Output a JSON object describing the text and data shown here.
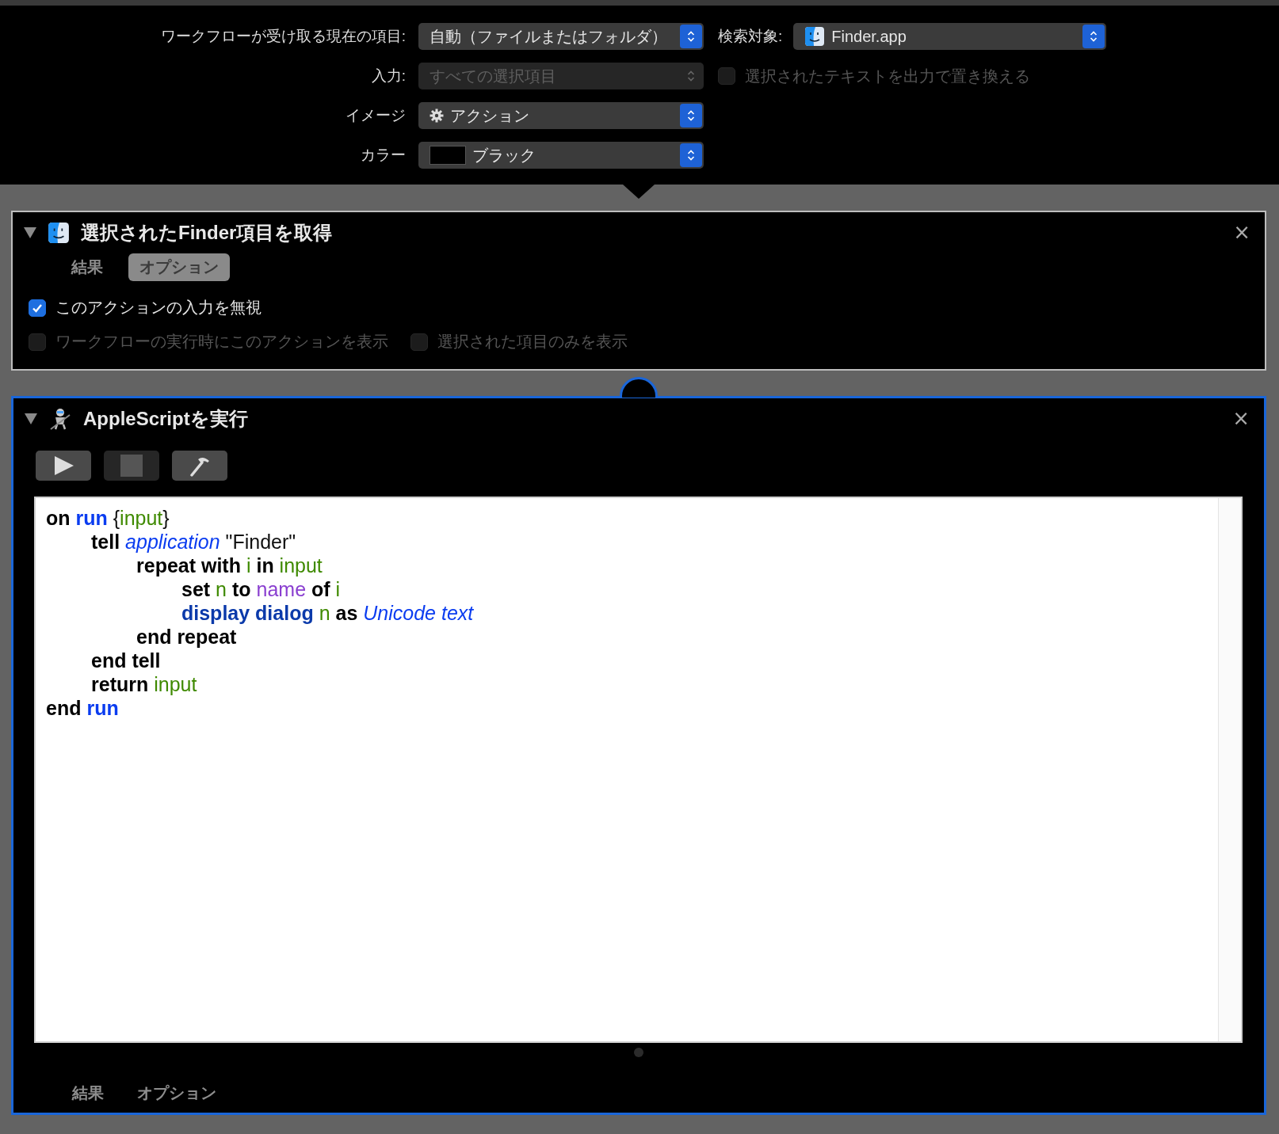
{
  "workflow_settings": {
    "rows": [
      {
        "label": "ワークフローが受け取る現在の項目:",
        "popup": {
          "kind": "plain",
          "value": "自動（ファイルまたはフォルダ）",
          "disabled": false
        },
        "extra": {
          "kind": "popup",
          "label": "検索対象:",
          "popup": {
            "kind": "app",
            "value": "Finder.app",
            "disabled": false
          }
        }
      },
      {
        "label": "入力:",
        "popup": {
          "kind": "plain",
          "value": "すべての選択項目",
          "disabled": true
        },
        "extra": {
          "kind": "checkbox",
          "label": "選択されたテキストを出力で置き換える",
          "checked": false,
          "disabled": true
        }
      },
      {
        "label": "イメージ",
        "popup": {
          "kind": "gear",
          "value": "アクション",
          "disabled": false
        }
      },
      {
        "label": "カラー",
        "popup": {
          "kind": "swatch",
          "value": "ブラック",
          "disabled": false
        }
      }
    ]
  },
  "actions": [
    {
      "kind": "finder",
      "title": "選択されたFinder項目を取得",
      "close": "×",
      "expanded": true,
      "focused": false,
      "tabs": [
        {
          "label": "結果",
          "selected": false
        },
        {
          "label": "オプション",
          "selected": true
        }
      ],
      "options": [
        [
          {
            "label": "このアクションの入力を無視",
            "checked": true,
            "disabled": false
          }
        ],
        [
          {
            "label": "ワークフローの実行時にこのアクションを表示",
            "checked": false,
            "disabled": true
          },
          {
            "label": "選択された項目のみを表示",
            "checked": false,
            "disabled": true
          }
        ]
      ]
    },
    {
      "kind": "script",
      "title": "AppleScriptを実行",
      "close": "×",
      "expanded": true,
      "focused": true,
      "toolbar": [
        {
          "kind": "run"
        },
        {
          "kind": "stop"
        },
        {
          "kind": "compile"
        }
      ],
      "code": [
        [
          {
            "kind": "keyword",
            "text": "on "
          },
          {
            "kind": "handler",
            "text": "run"
          },
          {
            "kind": "plain",
            "text": " {"
          },
          {
            "kind": "variable",
            "text": "input"
          },
          {
            "kind": "plain",
            "text": "}"
          }
        ],
        [
          {
            "kind": "keyword",
            "text": "\ttell "
          },
          {
            "kind": "class",
            "text": "application"
          },
          {
            "kind": "plain",
            "text": " \"Finder\""
          }
        ],
        [
          {
            "kind": "keyword",
            "text": "\t\trepeat with "
          },
          {
            "kind": "variable",
            "text": "i"
          },
          {
            "kind": "keyword",
            "text": " in "
          },
          {
            "kind": "variable",
            "text": "input"
          }
        ],
        [
          {
            "kind": "keyword",
            "text": "\t\t\tset "
          },
          {
            "kind": "variable",
            "text": "n"
          },
          {
            "kind": "keyword",
            "text": " to "
          },
          {
            "kind": "property",
            "text": "name"
          },
          {
            "kind": "keyword",
            "text": " of "
          },
          {
            "kind": "variable",
            "text": "i"
          }
        ],
        [
          {
            "kind": "command",
            "text": "\t\t\tdisplay dialog"
          },
          {
            "kind": "variable",
            "text": " n"
          },
          {
            "kind": "keyword",
            "text": " as "
          },
          {
            "kind": "class",
            "text": "Unicode text"
          }
        ],
        [
          {
            "kind": "keyword",
            "text": "\t\tend repeat"
          }
        ],
        [
          {
            "kind": "keyword",
            "text": "\tend tell"
          }
        ],
        [
          {
            "kind": "keyword",
            "text": "\treturn "
          },
          {
            "kind": "variable",
            "text": "input"
          }
        ],
        [
          {
            "kind": "keyword",
            "text": "end "
          },
          {
            "kind": "handler",
            "text": "run"
          }
        ]
      ],
      "tabs": [
        {
          "label": "結果",
          "selected": false
        },
        {
          "label": "オプション",
          "selected": false
        }
      ]
    }
  ]
}
